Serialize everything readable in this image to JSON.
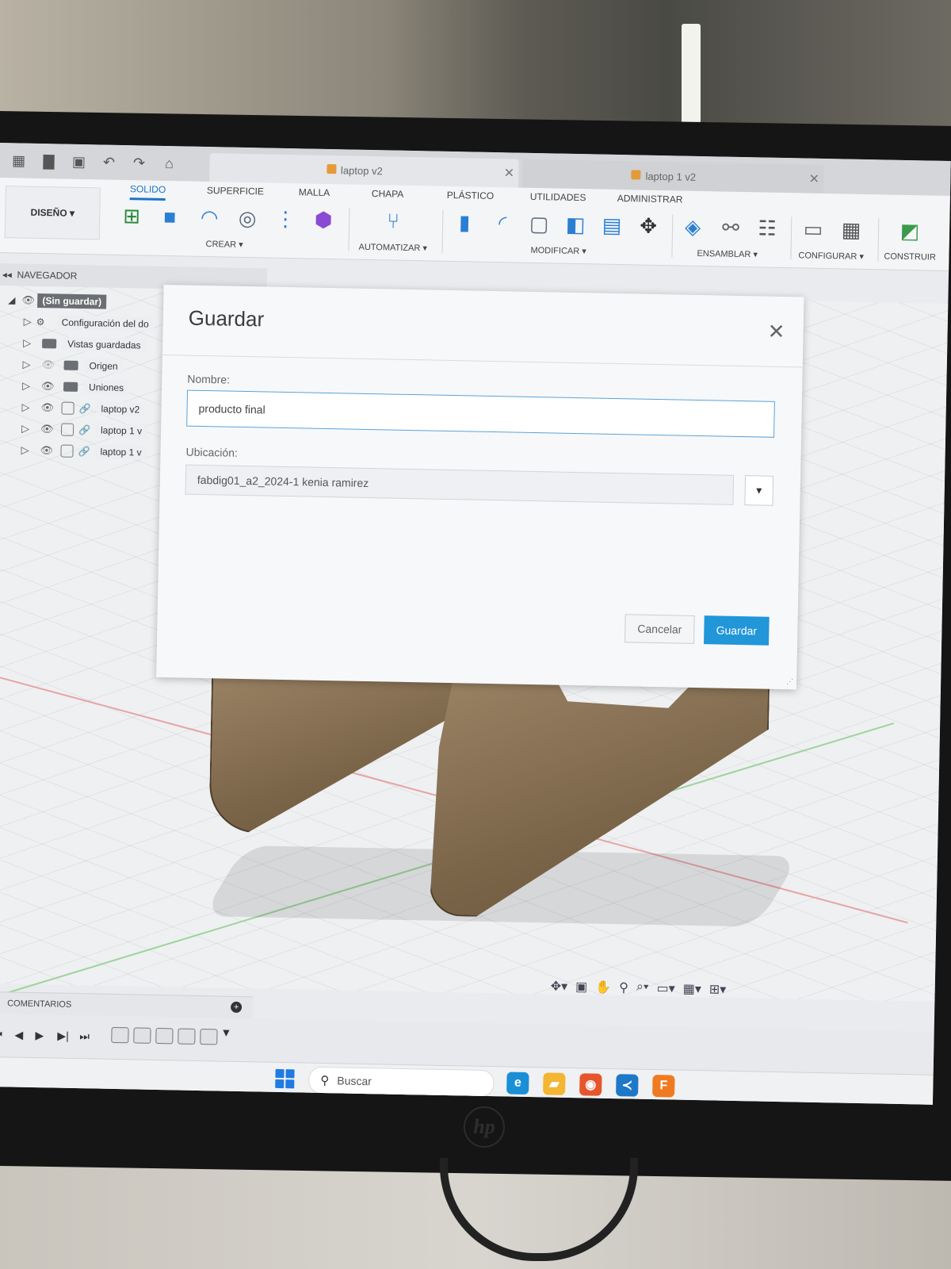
{
  "tabs": [
    {
      "label": "laptop v2",
      "active": true
    },
    {
      "label": "laptop 1 v2",
      "active": false
    }
  ],
  "toolbar": {
    "workspace_label": "DISEÑO",
    "ribbon_tabs": [
      "SOLIDO",
      "SUPERFICIE",
      "MALLA",
      "CHAPA",
      "PLÁSTICO",
      "UTILIDADES",
      "ADMINISTRAR"
    ],
    "groups": [
      "CREAR",
      "AUTOMATIZAR",
      "MODIFICAR",
      "ENSAMBLAR",
      "CONFIGURAR",
      "CONSTRUIR"
    ]
  },
  "browser": {
    "title": "NAVEGADOR",
    "root": "(Sin guardar)",
    "items": [
      {
        "label": "Configuración del do"
      },
      {
        "label": "Vistas guardadas"
      },
      {
        "label": "Origen"
      },
      {
        "label": "Uniones"
      },
      {
        "label": "laptop v2"
      },
      {
        "label": "laptop 1 v"
      },
      {
        "label": "laptop 1 v"
      }
    ]
  },
  "comments": {
    "label": "COMENTARIOS"
  },
  "taskbar": {
    "search_placeholder": "Buscar"
  },
  "dialog": {
    "title": "Guardar",
    "name_label": "Nombre:",
    "name_value": "producto final",
    "location_label": "Ubicación:",
    "location_value": "fabdig01_a2_2024-1 kenia ramirez",
    "cancel_label": "Cancelar",
    "save_label": "Guardar"
  },
  "colors": {
    "accent": "#2196d8",
    "input_focus": "#5aa3d8",
    "wood": "#7a6448"
  }
}
